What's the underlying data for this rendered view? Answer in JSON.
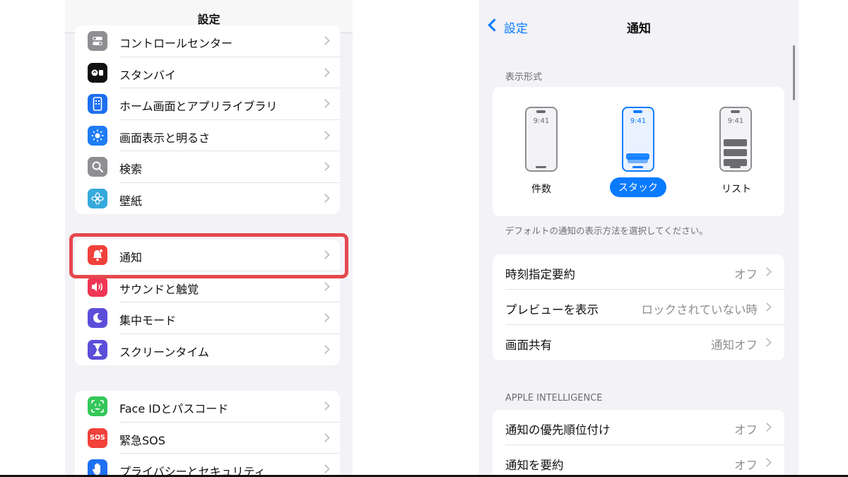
{
  "left": {
    "title": "設定",
    "group1": [
      {
        "label": "コントロールセンター",
        "icon": "control-center-icon",
        "color": "#8e8e93"
      },
      {
        "label": "スタンバイ",
        "icon": "standby-icon",
        "color": "#111111"
      },
      {
        "label": "ホーム画面とアプリライブラリ",
        "icon": "home-screen-icon",
        "color": "#1e6ff1"
      },
      {
        "label": "画面表示と明るさ",
        "icon": "brightness-icon",
        "color": "#1e7cf5"
      },
      {
        "label": "検索",
        "icon": "search-icon",
        "color": "#8e8e93"
      },
      {
        "label": "壁紙",
        "icon": "wallpaper-icon",
        "color": "#35aadc"
      }
    ],
    "group2": [
      {
        "label": "通知",
        "icon": "notification-icon",
        "color": "#f0413a"
      },
      {
        "label": "サウンドと触覚",
        "icon": "sound-icon",
        "color": "#f03555"
      },
      {
        "label": "集中モード",
        "icon": "focus-moon-icon",
        "color": "#5b4fd9"
      },
      {
        "label": "スクリーンタイム",
        "icon": "hourglass-icon",
        "color": "#5b4fd9"
      }
    ],
    "group3": [
      {
        "label": "Face IDとパスコード",
        "icon": "face-id-icon",
        "color": "#34c759"
      },
      {
        "label": "緊急SOS",
        "icon": "sos-icon",
        "color": "#f0413a",
        "icon_text": "SOS"
      },
      {
        "label": "プライバシーとセキュリティ",
        "icon": "hand-icon",
        "color": "#1e6ff1"
      }
    ],
    "highlight_color": "#e5484d"
  },
  "right": {
    "back_label": "設定",
    "title": "通知",
    "display_section": "表示形式",
    "display_options": [
      {
        "label": "件数",
        "time": "9:41",
        "selected": false
      },
      {
        "label": "スタック",
        "time": "9:41",
        "selected": true
      },
      {
        "label": "リスト",
        "time": "9:41",
        "selected": false
      }
    ],
    "display_footer": "デフォルトの通知の表示方法を選択してください。",
    "rows1": [
      {
        "label": "時刻指定要約",
        "value": "オフ"
      },
      {
        "label": "プレビューを表示",
        "value": "ロックされていない時"
      },
      {
        "label": "画面共有",
        "value": "通知オフ"
      }
    ],
    "ai_section": "APPLE INTELLIGENCE",
    "rows2": [
      {
        "label": "通知の優先順位付け",
        "value": "オフ"
      },
      {
        "label": "通知を要約",
        "value": "オフ"
      }
    ],
    "accent": "#0a7aff"
  }
}
